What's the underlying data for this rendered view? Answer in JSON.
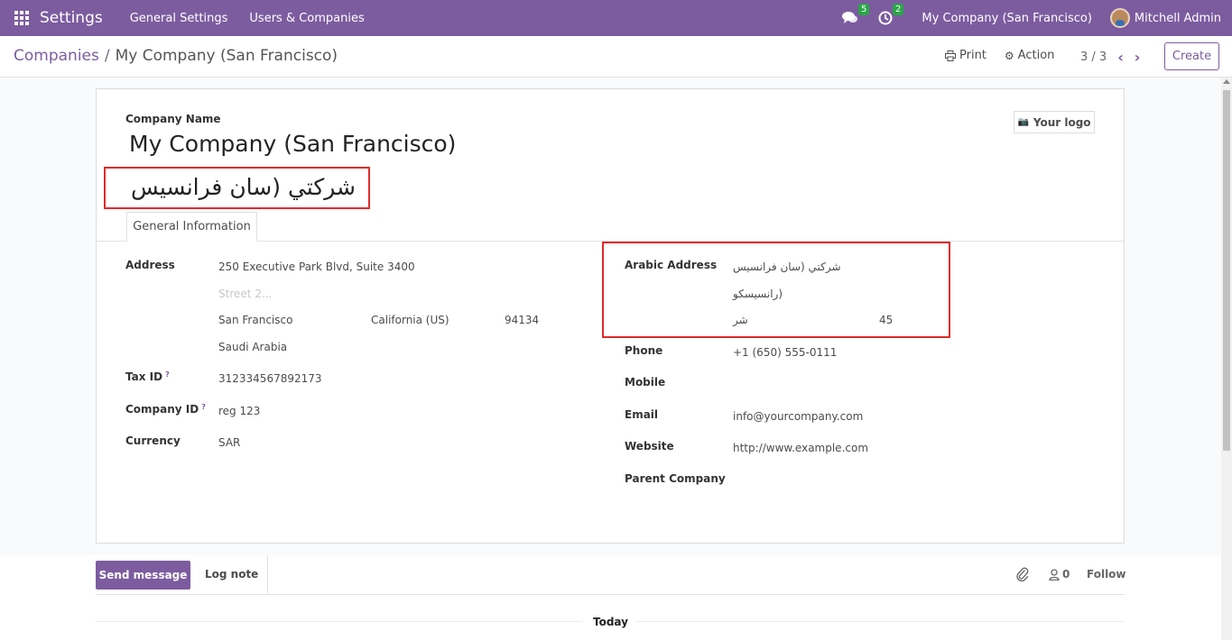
{
  "navbar": {
    "app_title": "Settings",
    "menu": [
      "General Settings",
      "Users & Companies"
    ],
    "messages_count": "5",
    "activities_count": "2",
    "company": "My Company (San Francisco)",
    "user": "Mitchell Admin"
  },
  "control_panel": {
    "breadcrumb_parent": "Companies",
    "breadcrumb_separator": "/",
    "breadcrumb_current": "My Company (San Francisco)",
    "print_label": "Print",
    "action_label": "Action",
    "pager": "3 / 3",
    "create_label": "Create"
  },
  "form": {
    "company_name_label": "Company Name",
    "company_name": "My Company (San Francisco)",
    "company_name_arabic": "شركتي (سان فرانسيس",
    "logo_label": "Your logo",
    "tab_general": "General Information",
    "address_label": "Address",
    "street": "250 Executive Park Blvd, Suite 3400",
    "street2_placeholder": "Street 2...",
    "city": "San Francisco",
    "state": "California (US)",
    "zip": "94134",
    "country": "Saudi Arabia",
    "tax_id_label": "Tax ID",
    "tax_id": "312334567892173",
    "company_id_label": "Company ID",
    "company_id": "reg 123",
    "currency_label": "Currency",
    "currency": "SAR",
    "help_mark": "?",
    "arabic_address_label": "Arabic Address",
    "arabic_street": "شركتي (سان فرانسيس",
    "arabic_street2": "(رانسيسكو",
    "arabic_city": "شر",
    "arabic_zip": "45",
    "phone_label": "Phone",
    "phone": "+1 (650) 555-0111",
    "mobile_label": "Mobile",
    "email_label": "Email",
    "email": "info@yourcompany.com",
    "website_label": "Website",
    "website": "http://www.example.com",
    "parent_company_label": "Parent Company"
  },
  "chatter": {
    "send_message": "Send message",
    "log_note": "Log note",
    "followers_count": "0",
    "follow": "Follow",
    "today": "Today"
  },
  "colors": {
    "brand": "#7c5c9f",
    "highlight_box": "#e12a2a",
    "badge": "#28a745"
  }
}
